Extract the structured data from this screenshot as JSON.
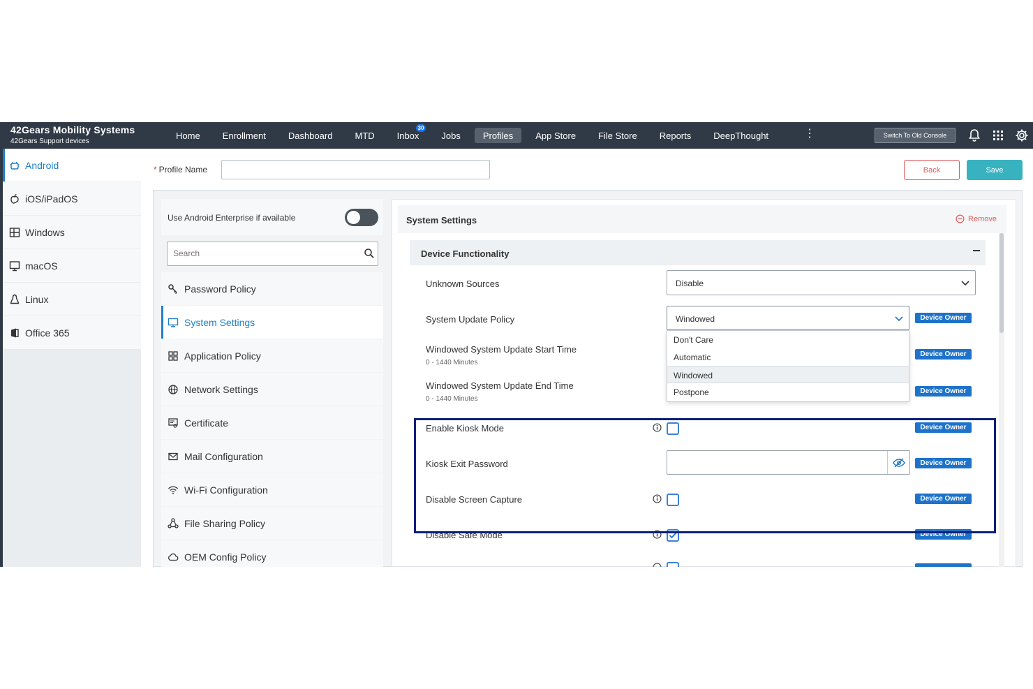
{
  "brand": {
    "title": "42Gears Mobility Systems",
    "subtitle": "42Gears Support devices"
  },
  "nav": {
    "items": [
      "Home",
      "Enrollment",
      "Dashboard",
      "MTD",
      "Inbox",
      "Jobs",
      "Profiles",
      "App Store",
      "File Store",
      "Reports",
      "DeepThought"
    ],
    "active": "Profiles",
    "inbox_badge": "30",
    "switch_label": "Switch To Old Console"
  },
  "sidebar": {
    "items": [
      {
        "label": "Android",
        "icon": "android-icon"
      },
      {
        "label": "iOS/iPadOS",
        "icon": "apple-icon"
      },
      {
        "label": "Windows",
        "icon": "windows-icon"
      },
      {
        "label": "macOS",
        "icon": "monitor-icon"
      },
      {
        "label": "Linux",
        "icon": "linux-icon"
      },
      {
        "label": "Office 365",
        "icon": "office-icon"
      }
    ],
    "active": "Android"
  },
  "profile": {
    "name_label": "Profile Name",
    "name_value": "",
    "back_label": "Back",
    "save_label": "Save"
  },
  "policy_list": {
    "enterprise_label": "Use Android Enterprise if available",
    "enterprise_enabled": false,
    "search_placeholder": "Search",
    "items": [
      {
        "label": "Password Policy",
        "icon": "key-icon"
      },
      {
        "label": "System Settings",
        "icon": "monitor-icon"
      },
      {
        "label": "Application Policy",
        "icon": "grid-icon"
      },
      {
        "label": "Network Settings",
        "icon": "globe-icon"
      },
      {
        "label": "Certificate",
        "icon": "certificate-icon"
      },
      {
        "label": "Mail Configuration",
        "icon": "mail-icon"
      },
      {
        "label": "Wi-Fi Configuration",
        "icon": "wifi-icon"
      },
      {
        "label": "File Sharing Policy",
        "icon": "share-icon"
      },
      {
        "label": "OEM Config Policy",
        "icon": "cloud-icon"
      }
    ],
    "active": "System Settings"
  },
  "panel": {
    "title": "System Settings",
    "remove_label": "Remove",
    "section_title": "Device Functionality",
    "owner_badge": "Device Owner",
    "fields": {
      "unknown_sources": {
        "label": "Unknown Sources",
        "value": "Disable"
      },
      "system_update_policy": {
        "label": "System Update Policy",
        "value": "Windowed",
        "options": [
          "Don't Care",
          "Automatic",
          "Windowed",
          "Postpone"
        ]
      },
      "update_start": {
        "label": "Windowed System Update Start Time",
        "hint": "0 - 1440 Minutes"
      },
      "update_end": {
        "label": "Windowed System Update End Time",
        "hint": "0 - 1440 Minutes"
      },
      "kiosk_mode": {
        "label": "Enable Kiosk Mode",
        "checked": false
      },
      "kiosk_exit_password": {
        "label": "Kiosk Exit Password",
        "value": ""
      },
      "screen_capture": {
        "label": "Disable Screen Capture",
        "checked": false
      },
      "safe_mode": {
        "label": "Disable Safe Mode",
        "checked": true
      }
    }
  },
  "colors": {
    "topbar": "#2f3a46",
    "accent": "#1f7fc7",
    "badge": "#1d72c9",
    "save": "#39b2c0",
    "back": "#e05a5a",
    "highlight": "#0b1f7a"
  }
}
